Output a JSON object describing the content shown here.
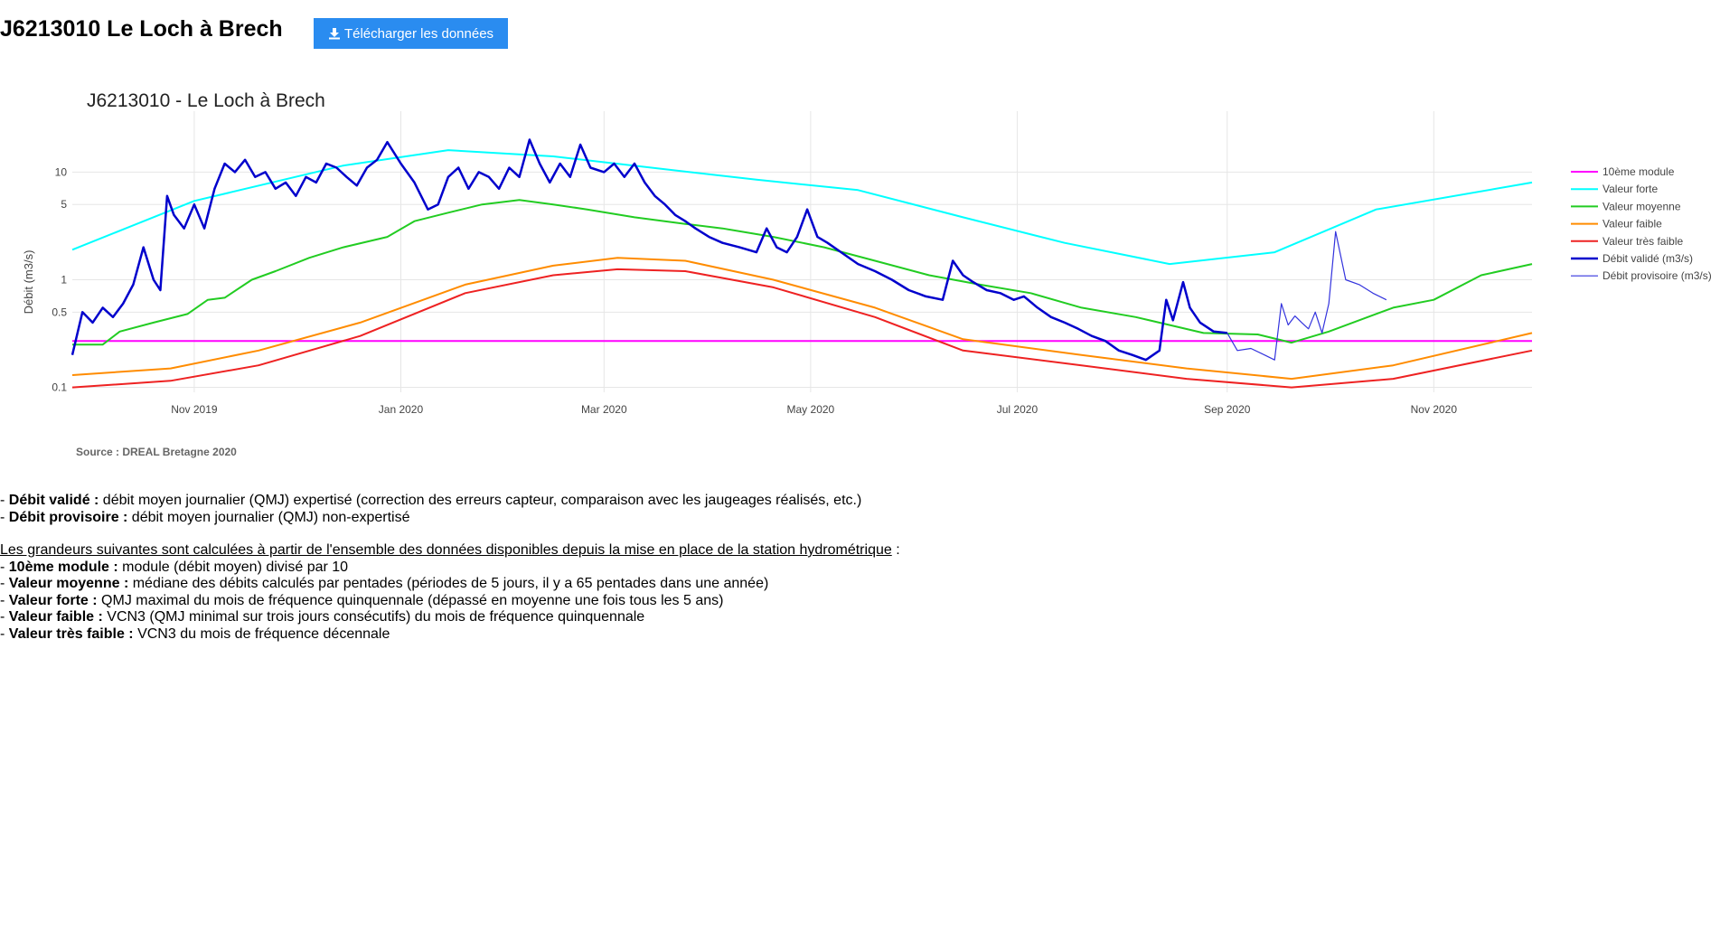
{
  "header": {
    "title": "J6213010 Le Loch à Brech",
    "download_label": "Télécharger les données"
  },
  "chart_data": {
    "type": "line",
    "title": "J6213010 - Le Loch à Brech",
    "ylabel": "Débit (m3/s)",
    "xlabel": "",
    "source": "Source : DREAL Bretagne 2020",
    "yscale": "log",
    "ylim": [
      0.09,
      25
    ],
    "xlim": [
      "2019-09-26",
      "2020-11-30"
    ],
    "x_ticks": [
      {
        "date": "2019-11-01",
        "label": "Nov 2019"
      },
      {
        "date": "2020-01-01",
        "label": "Jan 2020"
      },
      {
        "date": "2020-03-01",
        "label": "Mar 2020"
      },
      {
        "date": "2020-05-01",
        "label": "May 2020"
      },
      {
        "date": "2020-07-01",
        "label": "Jul 2020"
      },
      {
        "date": "2020-09-01",
        "label": "Sep 2020"
      },
      {
        "date": "2020-11-01",
        "label": "Nov 2020"
      }
    ],
    "y_ticks": [
      {
        "value": 0.1,
        "label": "0.1"
      },
      {
        "value": 0.5,
        "label": "0.5"
      },
      {
        "value": 1,
        "label": "1"
      },
      {
        "value": 5,
        "label": "5"
      },
      {
        "value": 10,
        "label": "10"
      }
    ],
    "grid": true,
    "legend_position": "right",
    "series": [
      {
        "name": "10ème module",
        "color": "#ff00ff",
        "width": 2,
        "points": [
          [
            "2019-09-26",
            0.27
          ],
          [
            "2020-11-30",
            0.27
          ]
        ]
      },
      {
        "name": "Valeur forte",
        "color": "#00ffff",
        "width": 2,
        "points": [
          [
            "2019-09-26",
            1.9
          ],
          [
            "2019-11-01",
            5.4
          ],
          [
            "2019-12-15",
            11.5
          ],
          [
            "2020-01-15",
            16
          ],
          [
            "2020-02-15",
            14
          ],
          [
            "2020-03-15",
            11
          ],
          [
            "2020-04-15",
            8.5
          ],
          [
            "2020-05-15",
            6.8
          ],
          [
            "2020-06-15",
            3.8
          ],
          [
            "2020-07-15",
            2.2
          ],
          [
            "2020-08-15",
            1.4
          ],
          [
            "2020-09-15",
            1.8
          ],
          [
            "2020-10-15",
            4.5
          ],
          [
            "2020-11-30",
            8
          ]
        ]
      },
      {
        "name": "Valeur moyenne",
        "color": "#22cc22",
        "width": 2,
        "points": [
          [
            "2019-09-26",
            0.25
          ],
          [
            "2019-10-05",
            0.25
          ],
          [
            "2019-10-10",
            0.33
          ],
          [
            "2019-10-20",
            0.4
          ],
          [
            "2019-10-30",
            0.48
          ],
          [
            "2019-11-05",
            0.65
          ],
          [
            "2019-11-10",
            0.68
          ],
          [
            "2019-11-18",
            1.0
          ],
          [
            "2019-11-25",
            1.2
          ],
          [
            "2019-12-05",
            1.6
          ],
          [
            "2019-12-15",
            2.0
          ],
          [
            "2019-12-28",
            2.5
          ],
          [
            "2020-01-05",
            3.5
          ],
          [
            "2020-01-15",
            4.2
          ],
          [
            "2020-01-25",
            5.0
          ],
          [
            "2020-02-05",
            5.5
          ],
          [
            "2020-02-15",
            5.0
          ],
          [
            "2020-02-25",
            4.5
          ],
          [
            "2020-03-10",
            3.8
          ],
          [
            "2020-03-25",
            3.3
          ],
          [
            "2020-04-05",
            3.0
          ],
          [
            "2020-04-20",
            2.5
          ],
          [
            "2020-05-05",
            2.0
          ],
          [
            "2020-05-20",
            1.5
          ],
          [
            "2020-06-05",
            1.1
          ],
          [
            "2020-06-20",
            0.9
          ],
          [
            "2020-07-05",
            0.75
          ],
          [
            "2020-07-20",
            0.55
          ],
          [
            "2020-08-05",
            0.45
          ],
          [
            "2020-08-25",
            0.32
          ],
          [
            "2020-09-10",
            0.31
          ],
          [
            "2020-09-20",
            0.26
          ],
          [
            "2020-10-01",
            0.33
          ],
          [
            "2020-10-20",
            0.55
          ],
          [
            "2020-11-01",
            0.65
          ],
          [
            "2020-11-15",
            1.1
          ],
          [
            "2020-11-30",
            1.4
          ]
        ]
      },
      {
        "name": "Valeur faible",
        "color": "#ff8c00",
        "width": 2,
        "points": [
          [
            "2019-09-26",
            0.13
          ],
          [
            "2019-10-25",
            0.15
          ],
          [
            "2019-11-20",
            0.22
          ],
          [
            "2019-12-20",
            0.4
          ],
          [
            "2020-01-20",
            0.9
          ],
          [
            "2020-02-15",
            1.35
          ],
          [
            "2020-03-05",
            1.6
          ],
          [
            "2020-03-25",
            1.5
          ],
          [
            "2020-04-20",
            1.0
          ],
          [
            "2020-05-20",
            0.55
          ],
          [
            "2020-06-15",
            0.28
          ],
          [
            "2020-07-20",
            0.2
          ],
          [
            "2020-08-20",
            0.15
          ],
          [
            "2020-09-20",
            0.12
          ],
          [
            "2020-10-20",
            0.16
          ],
          [
            "2020-11-30",
            0.32
          ]
        ]
      },
      {
        "name": "Valeur très faible",
        "color": "#ee2222",
        "width": 2,
        "points": [
          [
            "2019-09-26",
            0.1
          ],
          [
            "2019-10-25",
            0.115
          ],
          [
            "2019-11-20",
            0.16
          ],
          [
            "2019-12-20",
            0.3
          ],
          [
            "2020-01-20",
            0.75
          ],
          [
            "2020-02-15",
            1.1
          ],
          [
            "2020-03-05",
            1.25
          ],
          [
            "2020-03-25",
            1.2
          ],
          [
            "2020-04-20",
            0.85
          ],
          [
            "2020-05-20",
            0.45
          ],
          [
            "2020-06-15",
            0.22
          ],
          [
            "2020-07-20",
            0.16
          ],
          [
            "2020-08-20",
            0.12
          ],
          [
            "2020-09-20",
            0.1
          ],
          [
            "2020-10-20",
            0.12
          ],
          [
            "2020-11-30",
            0.22
          ]
        ]
      },
      {
        "name": "Débit validé (m3/s)",
        "color": "#0000cc",
        "width": 2.5,
        "points": [
          [
            "2019-09-26",
            0.2
          ],
          [
            "2019-09-29",
            0.5
          ],
          [
            "2019-10-02",
            0.4
          ],
          [
            "2019-10-05",
            0.55
          ],
          [
            "2019-10-08",
            0.45
          ],
          [
            "2019-10-11",
            0.6
          ],
          [
            "2019-10-14",
            0.9
          ],
          [
            "2019-10-17",
            2.0
          ],
          [
            "2019-10-20",
            1.0
          ],
          [
            "2019-10-22",
            0.8
          ],
          [
            "2019-10-24",
            6.0
          ],
          [
            "2019-10-26",
            4.0
          ],
          [
            "2019-10-29",
            3.0
          ],
          [
            "2019-11-01",
            5.0
          ],
          [
            "2019-11-04",
            3.0
          ],
          [
            "2019-11-07",
            7.0
          ],
          [
            "2019-11-10",
            12
          ],
          [
            "2019-11-13",
            10
          ],
          [
            "2019-11-16",
            13
          ],
          [
            "2019-11-19",
            9
          ],
          [
            "2019-11-22",
            10
          ],
          [
            "2019-11-25",
            7
          ],
          [
            "2019-11-28",
            8
          ],
          [
            "2019-12-01",
            6
          ],
          [
            "2019-12-04",
            9
          ],
          [
            "2019-12-07",
            8
          ],
          [
            "2019-12-10",
            12
          ],
          [
            "2019-12-13",
            11
          ],
          [
            "2019-12-16",
            9
          ],
          [
            "2019-12-19",
            7.5
          ],
          [
            "2019-12-22",
            11
          ],
          [
            "2019-12-25",
            13
          ],
          [
            "2019-12-28",
            19
          ],
          [
            "2020-01-01",
            12
          ],
          [
            "2020-01-05",
            8
          ],
          [
            "2020-01-09",
            4.5
          ],
          [
            "2020-01-12",
            5
          ],
          [
            "2020-01-15",
            9
          ],
          [
            "2020-01-18",
            11
          ],
          [
            "2020-01-21",
            7
          ],
          [
            "2020-01-24",
            10
          ],
          [
            "2020-01-27",
            9
          ],
          [
            "2020-01-30",
            7
          ],
          [
            "2020-02-02",
            11
          ],
          [
            "2020-02-05",
            9
          ],
          [
            "2020-02-08",
            20
          ],
          [
            "2020-02-11",
            12
          ],
          [
            "2020-02-14",
            8
          ],
          [
            "2020-02-17",
            12
          ],
          [
            "2020-02-20",
            9
          ],
          [
            "2020-02-23",
            18
          ],
          [
            "2020-02-26",
            11
          ],
          [
            "2020-03-01",
            10
          ],
          [
            "2020-03-04",
            12
          ],
          [
            "2020-03-07",
            9
          ],
          [
            "2020-03-10",
            12
          ],
          [
            "2020-03-13",
            8
          ],
          [
            "2020-03-16",
            6
          ],
          [
            "2020-03-19",
            5
          ],
          [
            "2020-03-22",
            4
          ],
          [
            "2020-03-25",
            3.5
          ],
          [
            "2020-03-28",
            3
          ],
          [
            "2020-04-01",
            2.5
          ],
          [
            "2020-04-05",
            2.2
          ],
          [
            "2020-04-10",
            2.0
          ],
          [
            "2020-04-15",
            1.8
          ],
          [
            "2020-04-18",
            3.0
          ],
          [
            "2020-04-21",
            2.0
          ],
          [
            "2020-04-24",
            1.8
          ],
          [
            "2020-04-27",
            2.5
          ],
          [
            "2020-04-30",
            4.5
          ],
          [
            "2020-05-03",
            2.5
          ],
          [
            "2020-05-06",
            2.2
          ],
          [
            "2020-05-10",
            1.8
          ],
          [
            "2020-05-15",
            1.4
          ],
          [
            "2020-05-20",
            1.2
          ],
          [
            "2020-05-25",
            1.0
          ],
          [
            "2020-05-30",
            0.8
          ],
          [
            "2020-06-04",
            0.7
          ],
          [
            "2020-06-09",
            0.65
          ],
          [
            "2020-06-12",
            1.5
          ],
          [
            "2020-06-15",
            1.1
          ],
          [
            "2020-06-18",
            0.95
          ],
          [
            "2020-06-22",
            0.8
          ],
          [
            "2020-06-26",
            0.75
          ],
          [
            "2020-06-30",
            0.65
          ],
          [
            "2020-07-03",
            0.7
          ],
          [
            "2020-07-07",
            0.55
          ],
          [
            "2020-07-11",
            0.45
          ],
          [
            "2020-07-15",
            0.4
          ],
          [
            "2020-07-19",
            0.35
          ],
          [
            "2020-07-23",
            0.3
          ],
          [
            "2020-07-27",
            0.27
          ],
          [
            "2020-07-31",
            0.22
          ],
          [
            "2020-08-04",
            0.2
          ],
          [
            "2020-08-08",
            0.18
          ],
          [
            "2020-08-12",
            0.22
          ],
          [
            "2020-08-14",
            0.65
          ],
          [
            "2020-08-16",
            0.42
          ],
          [
            "2020-08-19",
            0.95
          ],
          [
            "2020-08-21",
            0.55
          ],
          [
            "2020-08-24",
            0.4
          ],
          [
            "2020-08-28",
            0.33
          ],
          [
            "2020-09-01",
            0.32
          ]
        ]
      },
      {
        "name": "Débit provisoire (m3/s)",
        "color": "#3333dd",
        "width": 1.2,
        "points": [
          [
            "2020-09-01",
            0.32
          ],
          [
            "2020-09-04",
            0.22
          ],
          [
            "2020-09-08",
            0.23
          ],
          [
            "2020-09-12",
            0.2
          ],
          [
            "2020-09-15",
            0.18
          ],
          [
            "2020-09-17",
            0.6
          ],
          [
            "2020-09-19",
            0.38
          ],
          [
            "2020-09-21",
            0.46
          ],
          [
            "2020-09-23",
            0.4
          ],
          [
            "2020-09-25",
            0.35
          ],
          [
            "2020-09-27",
            0.5
          ],
          [
            "2020-09-29",
            0.32
          ],
          [
            "2020-10-01",
            0.6
          ],
          [
            "2020-10-03",
            2.8
          ],
          [
            "2020-10-06",
            1.0
          ],
          [
            "2020-10-10",
            0.9
          ],
          [
            "2020-10-14",
            0.75
          ],
          [
            "2020-10-18",
            0.65
          ]
        ]
      }
    ]
  },
  "notes": {
    "validated_label": "Débit validé :",
    "validated_text": " débit moyen journalier (QMJ) expertisé (correction des erreurs capteur, comparaison avec les jaugeages réalisés, etc.)",
    "provisional_label": "Débit provisoire :",
    "provisional_text": " débit moyen journalier (QMJ) non-expertisé",
    "intro": "Les grandeurs suivantes sont calculées à partir de l'ensemble des données disponibles depuis la mise en place de la station hydrométrique",
    "intro_suffix": " :",
    "module_label": "10ème module :",
    "module_text": " module (débit moyen) divisé par 10",
    "moyenne_label": "Valeur moyenne :",
    "moyenne_text": " médiane des débits calculés par pentades (périodes de 5 jours, il y a 65 pentades dans une année)",
    "forte_label": "Valeur forte :",
    "forte_text": " QMJ maximal du mois de fréquence quinquennale (dépassé en moyenne une fois tous les 5 ans)",
    "faible_label": "Valeur faible :",
    "faible_text": " VCN3 (QMJ minimal sur trois jours consécutifs) du mois de fréquence quinquennale",
    "tresfaible_label": "Valeur très faible :",
    "tresfaible_text": " VCN3 du mois de fréquence décennale"
  }
}
